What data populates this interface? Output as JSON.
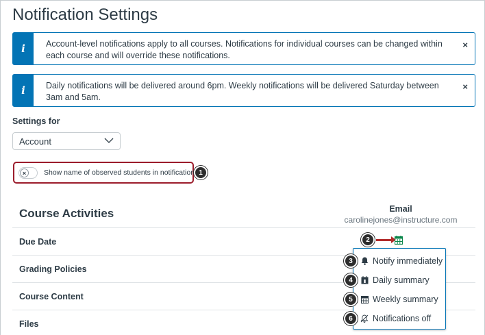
{
  "page": {
    "title": "Notification Settings"
  },
  "alerts": [
    {
      "icon": "info-icon",
      "glyph": "i",
      "text": "Account-level notifications apply to all courses. Notifications for individual courses can be changed within each course and will override these notifications.",
      "close": "×"
    },
    {
      "icon": "info-icon",
      "glyph": "i",
      "text": "Daily notifications will be delivered around 6pm. Weekly notifications will be delivered Saturday between 3am and 5am.",
      "close": "×"
    }
  ],
  "settings": {
    "label": "Settings for",
    "selected": "Account",
    "chevron": "⌵"
  },
  "toggle": {
    "label": "Show name of observed students in notifications",
    "state": "off",
    "knob": "×"
  },
  "callouts": [
    "1",
    "2",
    "3",
    "4",
    "5",
    "6"
  ],
  "table": {
    "section_title": "Course Activities",
    "channel_name": "Email",
    "channel_address": "carolinejones@instructure.com",
    "rows": [
      "Due Date",
      "Grading Policies",
      "Course Content",
      "Files"
    ]
  },
  "menu": {
    "items": [
      {
        "label": "Notify immediately",
        "icon": "bell-icon"
      },
      {
        "label": "Daily summary",
        "icon": "calendar-day-icon"
      },
      {
        "label": "Weekly summary",
        "icon": "calendar-week-icon"
      },
      {
        "label": "Notifications off",
        "icon": "bell-off-icon"
      }
    ]
  },
  "colors": {
    "brand": "#0374b5",
    "highlight": "#9b1c2b",
    "active_icon": "#0b874b",
    "arrow": "#b12a2a"
  }
}
